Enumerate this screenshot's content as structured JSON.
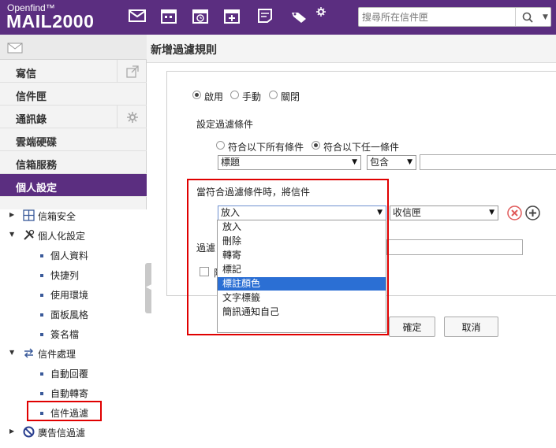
{
  "brand": {
    "small": "Openfind™",
    "big": "MAIL2000"
  },
  "toolbar_icons": [
    "mail-icon",
    "calendar-icon",
    "schedule-icon",
    "add-event-icon",
    "note-icon",
    "tag-icon",
    "settings-icon"
  ],
  "search": {
    "placeholder": "搜尋所在信件匣"
  },
  "sidebar": {
    "menu": [
      {
        "label": "寫信"
      },
      {
        "label": "信件匣"
      },
      {
        "label": "通訊錄"
      },
      {
        "label": "雲端硬碟"
      },
      {
        "label": "信箱服務"
      },
      {
        "label": "個人設定"
      }
    ],
    "tree": [
      {
        "label": "信箱安全"
      },
      {
        "label": "個人化設定"
      },
      {
        "label": "個人資料"
      },
      {
        "label": "快捷列"
      },
      {
        "label": "使用環境"
      },
      {
        "label": "面板風格"
      },
      {
        "label": "簽名檔"
      },
      {
        "label": "信件處理"
      },
      {
        "label": "自動回覆"
      },
      {
        "label": "自動轉寄"
      },
      {
        "label": "信件過濾"
      },
      {
        "label": "廣告信過濾"
      }
    ]
  },
  "main": {
    "title": "新增過濾規則",
    "mode": {
      "options": [
        "啟用",
        "手動",
        "關閉"
      ],
      "selected": "啟用"
    },
    "condition_label": "設定過濾條件",
    "match": {
      "options": [
        "符合以下所有條件",
        "符合以下任一條件"
      ],
      "selected": "符合以下任一條件"
    },
    "field_select": "標題",
    "op_select": "包含",
    "action_label": "當符合過濾條件時，將信件",
    "action_select": "放入",
    "folder_select": "收信匣",
    "action_options": [
      "放入",
      "刪除",
      "轉寄",
      "標記",
      "標註顏色",
      "文字標籤",
      "簡訊通知自己"
    ],
    "action_highlighted": "標註顏色",
    "name_label_visible": "過濾",
    "checkbox_label_visible": "附",
    "buttons": {
      "ok": "確定",
      "cancel": "取消"
    }
  },
  "colors": {
    "brand_purple": "#5b2e80",
    "highlight_red": "#e00000",
    "option_selected": "#2b6fd4"
  }
}
